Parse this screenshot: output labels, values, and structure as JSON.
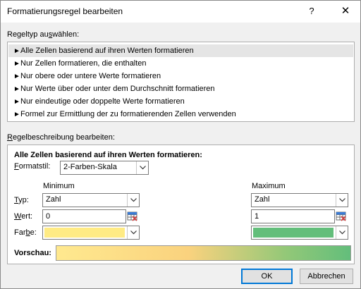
{
  "window": {
    "title": "Formatierungsregel bearbeiten",
    "help": "?",
    "close": "✕"
  },
  "rule_type": {
    "label_pre": "Regeltyp au",
    "label_u": "s",
    "label_post": "wählen:",
    "items": [
      "Alle Zellen basierend auf ihren Werten formatieren",
      "Nur Zellen formatieren, die enthalten",
      "Nur obere oder untere Werte formatieren",
      "Nur Werte über oder unter dem Durchschnitt formatieren",
      "Nur eindeutige oder doppelte Werte formatieren",
      "Formel zur Ermittlung der zu formatierenden Zellen verwenden"
    ],
    "selected_index": 0,
    "arrow": "►"
  },
  "rule_desc": {
    "label_u": "R",
    "label_post": "egelbeschreibung bearbeiten:",
    "heading": "Alle Zellen basierend auf ihren Werten formatieren:",
    "format_style_label_u": "F",
    "format_style_label_post": "ormatstil:",
    "format_style_value": "2-Farben-Skala",
    "minimum_label": "Minimum",
    "maximum_label": "Maximum",
    "type_label_u": "T",
    "type_label_post": "yp:",
    "value_label_u": "W",
    "value_label_post": "ert:",
    "color_label_pre": "Far",
    "color_label_u": "b",
    "color_label_post": "e:",
    "min_type": "Zahl",
    "max_type": "Zahl",
    "min_value": "0",
    "max_value": "1",
    "min_color": "#ffeb84",
    "max_color": "#63be7b",
    "preview_label": "Vorschau:"
  },
  "buttons": {
    "ok": "OK",
    "cancel": "Abbrechen"
  }
}
